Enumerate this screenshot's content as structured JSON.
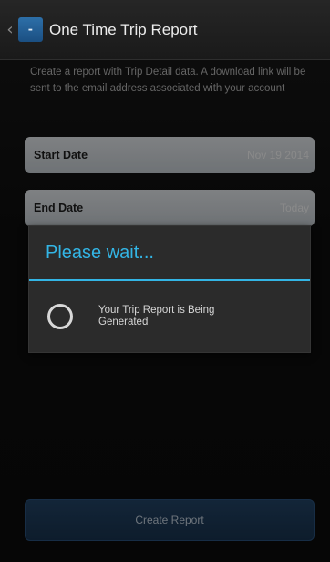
{
  "header": {
    "back_glyph": "‹",
    "app_icon": "app-logo-icon",
    "title": "One Time Trip Report"
  },
  "main": {
    "description": "Create a report with Trip Detail data. A download link will be sent to the email address associated with your account",
    "start_date": {
      "label": "Start Date",
      "value": "Nov 19 2014"
    },
    "end_date": {
      "label": "End Date",
      "value": "Today"
    },
    "create_button_label": "Create Report"
  },
  "dialog": {
    "title": "Please wait...",
    "message": "Your Trip Report is Being Generated"
  },
  "colors": {
    "accent": "#33b5e5",
    "button": "#1e3a57",
    "field": "#b5babe"
  }
}
